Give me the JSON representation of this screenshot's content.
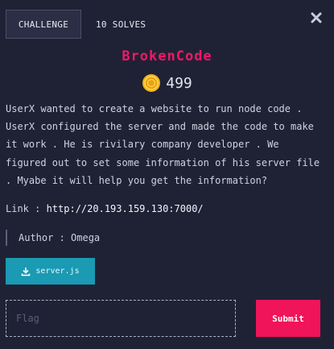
{
  "tabs": {
    "challenge_label": "CHALLENGE",
    "solves_label": "10 SOLVES"
  },
  "close_icon": "close-icon",
  "challenge": {
    "name": "BrokenCode",
    "points": "499",
    "description": "UserX wanted to create a website to run node code .\nUserX configured the server and made the code to make\nit work . He is rivilary company developer . We\nfigured out to set some information of his server file\n. Myabe it will help you get the information?",
    "link_label": "Link : ",
    "link_url": "http://20.193.159.130:7000/",
    "author": "Author : Omega",
    "file_name": "server.js"
  },
  "form": {
    "flag_placeholder": "Flag",
    "submit_label": "Submit"
  },
  "colors": {
    "background": "#1f2235",
    "title": "#f0186a",
    "file_button": "#1a9ab3",
    "submit_button": "#f0145a",
    "coin": "#f2b51c"
  },
  "icons": {
    "coin": "coin-icon",
    "download": "download-icon"
  }
}
